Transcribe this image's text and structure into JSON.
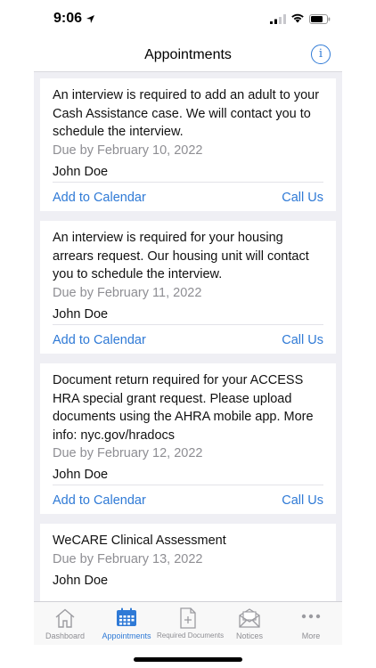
{
  "status_bar": {
    "time": "9:06"
  },
  "header": {
    "title": "Appointments"
  },
  "appointments": [
    {
      "title": "An interview is required to add an adult to your Cash Assistance case. We will contact you to schedule the interview.",
      "due": "Due by February 10, 2022",
      "name": "John Doe",
      "add_calendar": "Add to Calendar",
      "call": "Call Us"
    },
    {
      "title": "An interview is required for your housing arrears request. Our housing unit will contact you to schedule the interview.",
      "due": "Due by February 11, 2022",
      "name": "John Doe",
      "add_calendar": "Add to Calendar",
      "call": "Call Us"
    },
    {
      "title": "Document return required for your ACCESS HRA special grant request. Please upload documents using the AHRA mobile app. More info: nyc.gov/hradocs",
      "due": "Due by February 12, 2022",
      "name": "John Doe",
      "add_calendar": "Add to Calendar",
      "call": "Call Us"
    },
    {
      "title": "WeCARE Clinical Assessment",
      "due": "Due by February 13, 2022",
      "name": "John Doe"
    }
  ],
  "tabs": [
    {
      "label": "Dashboard",
      "icon": "home-icon"
    },
    {
      "label": "Appointments",
      "icon": "calendar-icon",
      "active": true
    },
    {
      "label": "Required Documents",
      "icon": "document-plus-icon"
    },
    {
      "label": "Notices",
      "icon": "mail-icon"
    },
    {
      "label": "More",
      "icon": "more-icon"
    }
  ],
  "colors": {
    "accent": "#2f7ad6",
    "background": "#efeff4",
    "inactive_tab": "#8e8e93"
  }
}
